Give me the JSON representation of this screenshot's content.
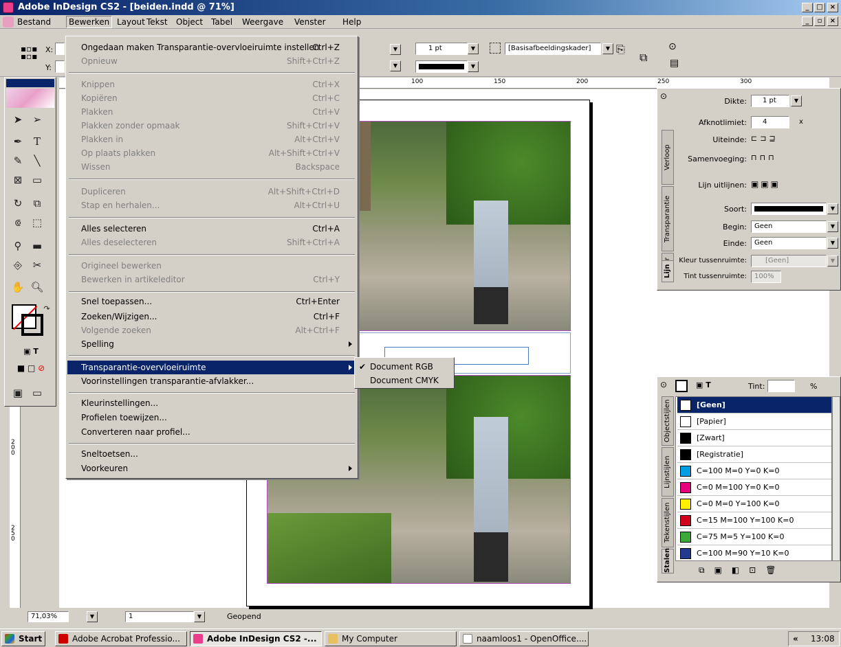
{
  "window": {
    "title": "Adobe InDesign CS2 - [beiden.indd @ 71%]"
  },
  "menubar": [
    {
      "label": "Bestand"
    },
    {
      "label": "Bewerken"
    },
    {
      "label": "Layout"
    },
    {
      "label": "Tekst"
    },
    {
      "label": "Object"
    },
    {
      "label": "Tabel"
    },
    {
      "label": "Weergave"
    },
    {
      "label": "Venster"
    },
    {
      "label": "Help"
    }
  ],
  "control": {
    "x_label": "X:",
    "y_label": "Y:",
    "stroke_weight": "1 pt",
    "object_style": "[Basisafbeeldingskader]"
  },
  "ruler": {
    "ticks": [
      "100",
      "150",
      "200",
      "250",
      "300"
    ],
    "vticks": [
      "200",
      "250"
    ]
  },
  "edit_menu": {
    "items": [
      {
        "label": "Ongedaan maken Transparantie-overvloeiruimte instellen",
        "shortcut": "Ctrl+Z"
      },
      {
        "label": "Opnieuw",
        "shortcut": "Shift+Ctrl+Z"
      },
      {
        "label": "Knippen",
        "shortcut": "Ctrl+X"
      },
      {
        "label": "Kopiëren",
        "shortcut": "Ctrl+C"
      },
      {
        "label": "Plakken",
        "shortcut": "Ctrl+V"
      },
      {
        "label": "Plakken zonder opmaak",
        "shortcut": "Shift+Ctrl+V"
      },
      {
        "label": "Plakken in",
        "shortcut": "Alt+Ctrl+V"
      },
      {
        "label": "Op plaats plakken",
        "shortcut": "Alt+Shift+Ctrl+V"
      },
      {
        "label": "Wissen",
        "shortcut": "Backspace"
      },
      {
        "label": "Dupliceren",
        "shortcut": "Alt+Shift+Ctrl+D"
      },
      {
        "label": "Stap en herhalen...",
        "shortcut": "Alt+Ctrl+U"
      },
      {
        "label": "Alles selecteren",
        "shortcut": "Ctrl+A"
      },
      {
        "label": "Alles deselecteren",
        "shortcut": "Shift+Ctrl+A"
      },
      {
        "label": "Origineel bewerken",
        "shortcut": ""
      },
      {
        "label": "Bewerken in artikeleditor",
        "shortcut": "Ctrl+Y"
      },
      {
        "label": "Snel toepassen...",
        "shortcut": "Ctrl+Enter"
      },
      {
        "label": "Zoeken/Wijzigen...",
        "shortcut": "Ctrl+F"
      },
      {
        "label": "Volgende zoeken",
        "shortcut": "Alt+Ctrl+F"
      },
      {
        "label": "Spelling",
        "shortcut": ""
      },
      {
        "label": "Transparantie-overvloeiruimte",
        "shortcut": ""
      },
      {
        "label": "Voorinstellingen transparantie-afvlakker...",
        "shortcut": ""
      },
      {
        "label": "Kleurinstellingen...",
        "shortcut": ""
      },
      {
        "label": "Profielen toewijzen...",
        "shortcut": ""
      },
      {
        "label": "Converteren naar profiel...",
        "shortcut": ""
      },
      {
        "label": "Sneltoetsen...",
        "shortcut": ""
      },
      {
        "label": "Voorkeuren",
        "shortcut": ""
      }
    ]
  },
  "submenu": {
    "items": [
      {
        "label": "Document RGB",
        "checked": "✔"
      },
      {
        "label": "Document CMYK",
        "checked": ""
      }
    ]
  },
  "stroke_panel": {
    "dikte_label": "Dikte:",
    "dikte_value": "1 pt",
    "afknot_label": "Afknotlimiet:",
    "afknot_value": "4",
    "afknot_unit": "x",
    "uiteinde_label": "Uiteinde:",
    "samenvoeging_label": "Samenvoeging:",
    "uitlijnen_label": "Lijn uitlijnen:",
    "soort_label": "Soort:",
    "begin_label": "Begin:",
    "begin_value": "Geen",
    "einde_label": "Einde:",
    "einde_value": "Geen",
    "kleur_label": "Kleur tussenruimte:",
    "kleur_value": "[Geen]",
    "tint_label": "Tint tussenruimte:",
    "tint_value": "100%",
    "tabs": [
      "Verloop",
      "Transparantie",
      "Kleur",
      "Lijn"
    ]
  },
  "swatches_panel": {
    "tint_label": "Tint:",
    "tint_unit": "%",
    "tabs": [
      "Objectstijlen",
      "Lijnstijlen",
      "Tekenstijlen",
      "Stalen"
    ],
    "rows": [
      {
        "name": "[Geen]",
        "color": "#ffffff"
      },
      {
        "name": "[Papier]",
        "color": "#ffffff"
      },
      {
        "name": "[Zwart]",
        "color": "#000000"
      },
      {
        "name": "[Registratie]",
        "color": "#000000"
      },
      {
        "name": "C=100 M=0 Y=0 K=0",
        "color": "#009fe3"
      },
      {
        "name": "C=0 M=100 Y=0 K=0",
        "color": "#e6007e"
      },
      {
        "name": "C=0 M=0 Y=100 K=0",
        "color": "#ffed00"
      },
      {
        "name": "C=15 M=100 Y=100 K=0",
        "color": "#d0021b"
      },
      {
        "name": "C=75 M=5 Y=100 K=0",
        "color": "#3aa935"
      },
      {
        "name": "C=100 M=90 Y=10 K=0",
        "color": "#213a8f"
      }
    ]
  },
  "statusbar": {
    "zoom": "71,03%",
    "page": "1",
    "status": "Geopend"
  },
  "taskbar": {
    "start": "Start",
    "items": [
      {
        "label": "Adobe Acrobat Professio..."
      },
      {
        "label": "Adobe InDesign CS2 -..."
      },
      {
        "label": "My Computer"
      },
      {
        "label": "naamloos1 - OpenOffice...."
      }
    ],
    "clock": "13:08",
    "chevron": "«"
  }
}
